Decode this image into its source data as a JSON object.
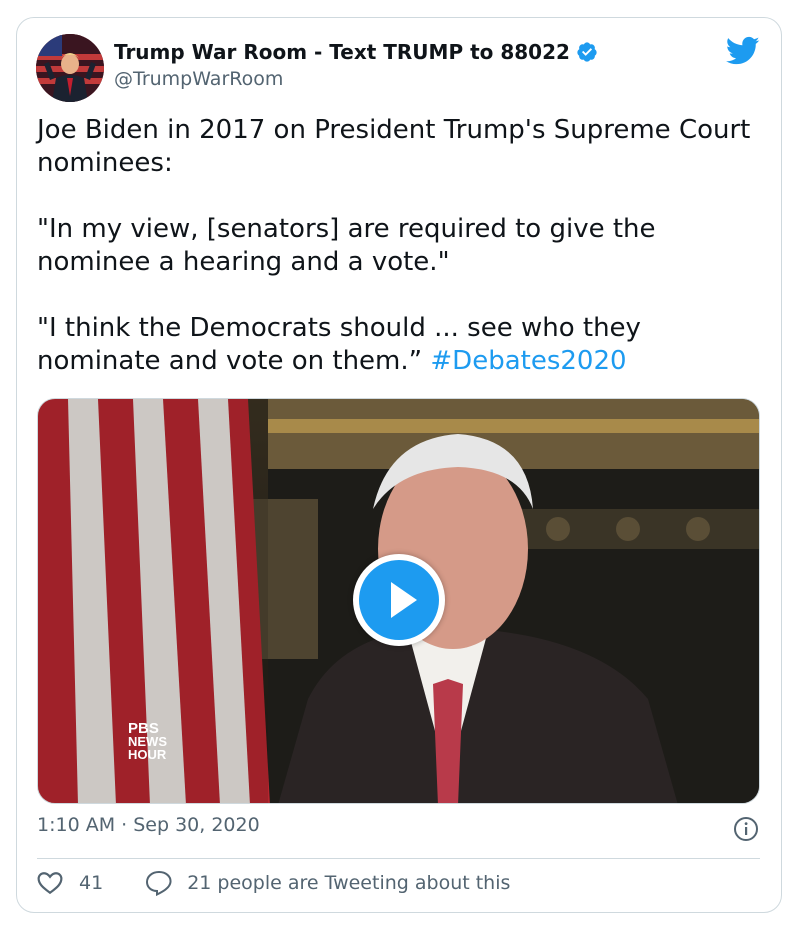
{
  "author": {
    "display_name": "Trump War Room - Text TRUMP to 88022",
    "handle": "@TrumpWarRoom",
    "verified": true
  },
  "tweet": {
    "paragraph_1": "Joe Biden in 2017 on President Trump's Supreme Court nominees:",
    "paragraph_2": "\"In my view, [senators] are required to give the nominee a hearing and a vote.\"",
    "paragraph_3": "\"I think the Democrats should ... see who they nominate and vote on them.”",
    "hashtag": "#Debates2020"
  },
  "media": {
    "type": "video",
    "watermark": "PBS NEWS HOUR"
  },
  "meta": {
    "timestamp": "1:10 AM · Sep 30, 2020"
  },
  "actions": {
    "like_count": "41",
    "talking_label": "21 people are Tweeting about this"
  },
  "colors": {
    "accent": "#1d9bf0",
    "text": "#0f1419",
    "muted": "#536471",
    "border": "#cfd9de"
  }
}
